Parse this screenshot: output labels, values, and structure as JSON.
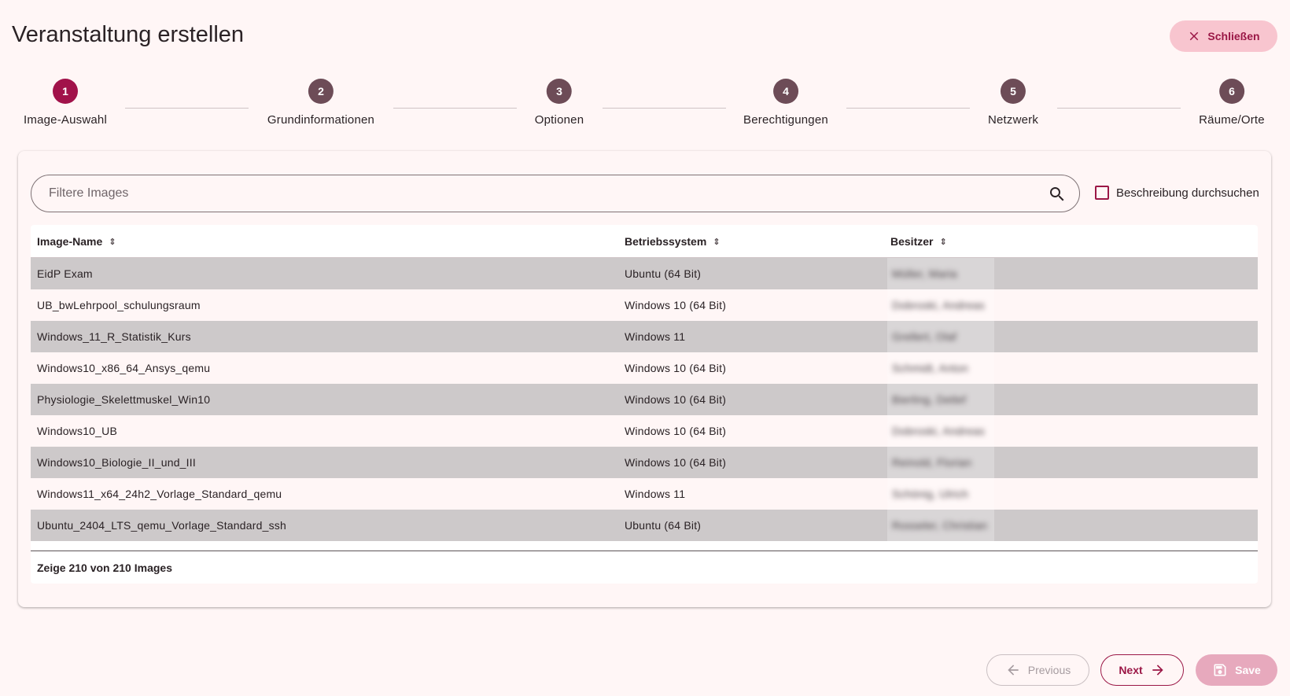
{
  "header": {
    "title": "Veranstaltung erstellen",
    "close_label": "Schließen"
  },
  "stepper": {
    "active_step": 1,
    "steps": [
      {
        "number": "1",
        "label": "Image-Auswahl"
      },
      {
        "number": "2",
        "label": "Grundinformationen"
      },
      {
        "number": "3",
        "label": "Optionen"
      },
      {
        "number": "4",
        "label": "Berechtigungen"
      },
      {
        "number": "5",
        "label": "Netzwerk"
      },
      {
        "number": "6",
        "label": "Räume/Orte"
      }
    ]
  },
  "filter": {
    "placeholder": "Filtere Images",
    "value": "",
    "search_description_label": "Beschreibung durchsuchen",
    "search_description_checked": false
  },
  "table": {
    "columns": [
      "Image-Name",
      "Betriebssystem",
      "Besitzer"
    ],
    "rows": [
      {
        "name": "EidP Exam",
        "os": "Ubuntu (64 Bit)",
        "owner": "Müller, Maria"
      },
      {
        "name": "UB_bwLehrpool_schulungsraum",
        "os": "Windows 10 (64 Bit)",
        "owner": "Dobroski, Andreas"
      },
      {
        "name": "Windows_11_R_Statistik_Kurs",
        "os": "Windows 11",
        "owner": "Grellert, Olaf"
      },
      {
        "name": "Windows10_x86_64_Ansys_qemu",
        "os": "Windows 10 (64 Bit)",
        "owner": "Schmidt, Anton"
      },
      {
        "name": "Physiologie_Skelettmuskel_Win10",
        "os": "Windows 10 (64 Bit)",
        "owner": "Bierling, Detlef"
      },
      {
        "name": "Windows10_UB",
        "os": "Windows 10 (64 Bit)",
        "owner": "Dobroski, Andreas"
      },
      {
        "name": "Windows10_Biologie_II_und_III",
        "os": "Windows 10 (64 Bit)",
        "owner": "Reinold, Florian"
      },
      {
        "name": "Windows11_x64_24h2_Vorlage_Standard_qemu",
        "os": "Windows 11",
        "owner": "Schönig, Ulrich"
      },
      {
        "name": "Ubuntu_2404_LTS_qemu_Vorlage_Standard_ssh",
        "os": "Ubuntu (64 Bit)",
        "owner": "Rosseler, Christian"
      }
    ],
    "footer": "Zeige 210 von 210 Images"
  },
  "actions": {
    "previous_label": "Previous",
    "next_label": "Next",
    "save_label": "Save"
  },
  "colors": {
    "primary": "#9b1746",
    "step_active": "#a1124a",
    "step_inactive": "#6d4c57",
    "background": "#fff6f6",
    "row_striped": "#cdc9ca"
  },
  "icons": {
    "close": "close-icon",
    "search": "search-icon",
    "sort": "sort-icon",
    "previous": "arrow-left-icon",
    "next": "arrow-right-icon",
    "save": "save-icon"
  }
}
